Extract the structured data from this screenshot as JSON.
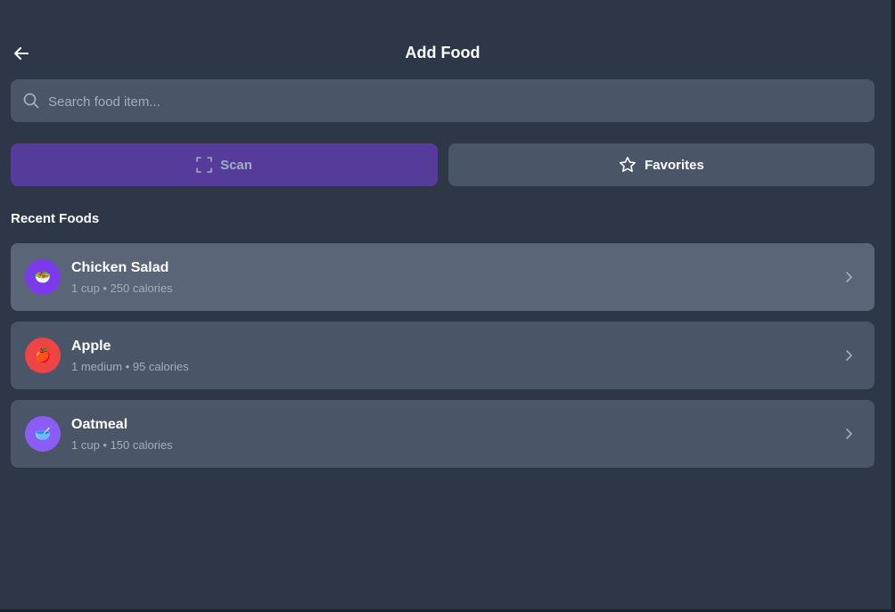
{
  "header": {
    "title": "Add Food"
  },
  "search": {
    "placeholder": "Search food item..."
  },
  "actions": {
    "scan_label": "Scan",
    "favorites_label": "Favorites"
  },
  "recent": {
    "title": "Recent Foods",
    "items": [
      {
        "name": "Chicken Salad",
        "meta": "1 cup • 250 calories",
        "emoji": "🥗",
        "icon": "salad-icon",
        "color": "#7c3aed"
      },
      {
        "name": "Apple",
        "meta": "1 medium • 95 calories",
        "emoji": "🍎",
        "icon": "apple-icon",
        "color": "#ef4444"
      },
      {
        "name": "Oatmeal",
        "meta": "1 cup • 150 calories",
        "emoji": "🥣",
        "icon": "bowl-icon",
        "color": "#8b5cf6"
      }
    ]
  },
  "colors": {
    "background": "#2d3748",
    "surface": "#4a5568",
    "accent": "#553c9a"
  }
}
